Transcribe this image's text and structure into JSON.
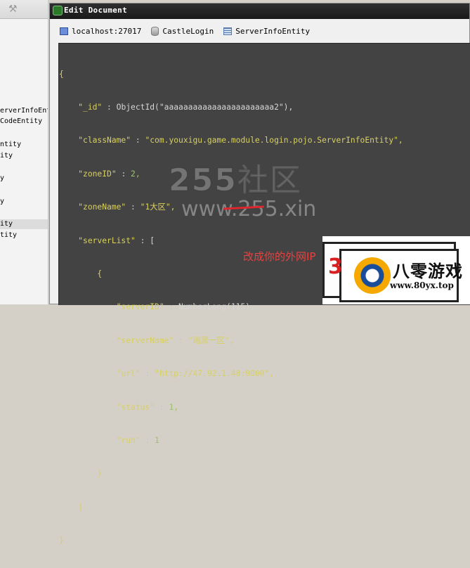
{
  "left_panel": {
    "items": [
      {
        "label": "erverInfoEnt",
        "selected": false
      },
      {
        "label": "CodeEntity",
        "selected": false
      },
      {
        "label": "ntity",
        "selected": false
      },
      {
        "label": "ity",
        "selected": false
      },
      {
        "label": "y",
        "selected": false
      },
      {
        "label": "y",
        "selected": false
      },
      {
        "label": "ity",
        "selected": true
      },
      {
        "label": "tity",
        "selected": false
      }
    ]
  },
  "dialog": {
    "title": "Edit Document",
    "breadcrumb": {
      "host": "localhost:27017",
      "database": "CastleLogin",
      "collection": "ServerInfoEntity"
    }
  },
  "document": {
    "open_brace": "{",
    "close_brace": "}",
    "id_key": "\"_id\"",
    "id_value": "ObjectId(\"aaaaaaaaaaaaaaaaaaaaaaa2\"),",
    "class_key": "\"className\"",
    "class_value": "\"com.youxigu.game.module.login.pojo.ServerInfoEntity\",",
    "zone_id_key": "\"zoneID\"",
    "zone_id_value": "2,",
    "zone_name_key": "\"zoneName\"",
    "zone_name_value": "\"1大区\",",
    "server_list_key": "\"serverList\"",
    "server_list_open": "[",
    "server_list_close": "]",
    "item_open": "{",
    "item_close": "}",
    "server_id_key": "\"serverID\"",
    "server_id_value": "NumberLong(115),",
    "server_name_key": "\"serverName\"",
    "server_name_value": "\"暗黑一区\",",
    "url_key": "\"url\"",
    "url_value": "\"http://47.92.1.48:9000\",",
    "status_key": "\"status\"",
    "status_value": "1,",
    "run_key": "\"run\"",
    "run_value": "1",
    "sep": " : "
  },
  "overlay": {
    "watermark_text": "255社区",
    "watermark_url": "www.255.xin",
    "annotation": "改成你的外网IP"
  },
  "logo": {
    "digit": "3",
    "name": "八零游戏",
    "url": "www.80yx.top"
  },
  "colors": {
    "editor_bg": "#434343",
    "string": "#d9d062",
    "number": "#9ec26a",
    "annotation": "#e8413f",
    "titlebar": "#1a1a1a"
  }
}
